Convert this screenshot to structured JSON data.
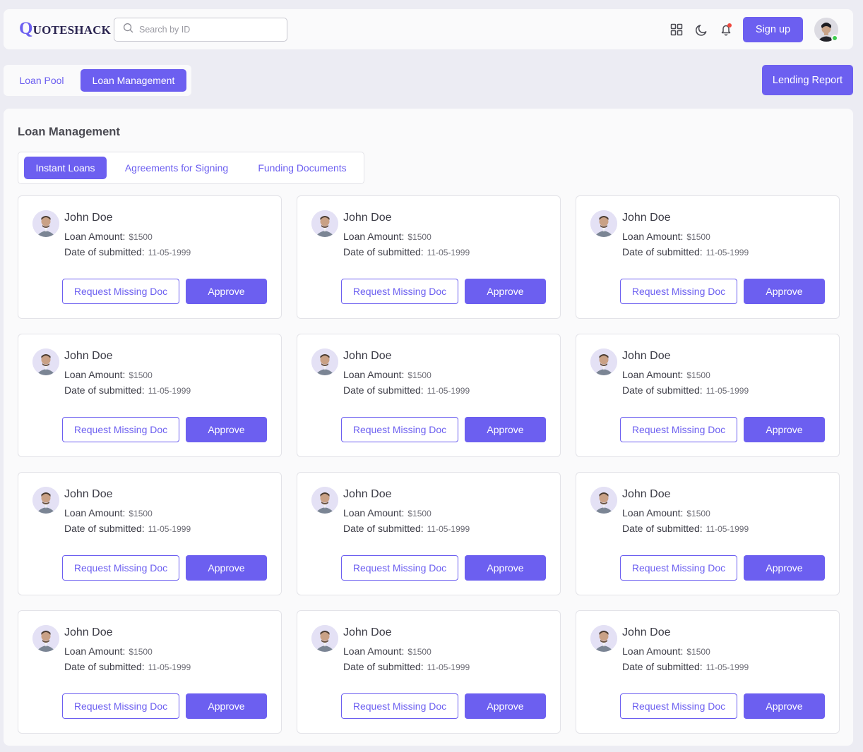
{
  "header": {
    "logo_initial": "Q",
    "logo_rest": "UOTESHACK",
    "search_placeholder": "Search by ID",
    "signup_label": "Sign up",
    "icons": [
      "search-icon",
      "grid-icon",
      "moon-icon",
      "bell-icon"
    ],
    "notification_dot_color": "#f0483e",
    "online_status_color": "#3ecb4f"
  },
  "main_tabs": [
    {
      "label": "Loan Pool",
      "active": false
    },
    {
      "label": "Loan Management",
      "active": true
    }
  ],
  "lending_report_label": "Lending Report",
  "panel": {
    "title": "Loan Management",
    "sub_tabs": [
      {
        "label": "Instant Loans",
        "active": true
      },
      {
        "label": "Agreements for Signing",
        "active": false
      },
      {
        "label": "Funding Documents",
        "active": false
      }
    ]
  },
  "cards": [
    {
      "name": "John Doe",
      "amount_label": "Loan Amount:",
      "amount": "$1500",
      "date_label": "Date of submitted:",
      "date": "11-05-1999",
      "request_label": "Request Missing Doc",
      "approve_label": "Approve"
    },
    {
      "name": "John Doe",
      "amount_label": "Loan Amount:",
      "amount": "$1500",
      "date_label": "Date of submitted:",
      "date": "11-05-1999",
      "request_label": "Request Missing Doc",
      "approve_label": "Approve"
    },
    {
      "name": "John Doe",
      "amount_label": "Loan Amount:",
      "amount": "$1500",
      "date_label": "Date of submitted:",
      "date": "11-05-1999",
      "request_label": "Request Missing Doc",
      "approve_label": "Approve"
    },
    {
      "name": "John Doe",
      "amount_label": "Loan Amount:",
      "amount": "$1500",
      "date_label": "Date of submitted:",
      "date": "11-05-1999",
      "request_label": "Request Missing Doc",
      "approve_label": "Approve"
    },
    {
      "name": "John Doe",
      "amount_label": "Loan Amount:",
      "amount": "$1500",
      "date_label": "Date of submitted:",
      "date": "11-05-1999",
      "request_label": "Request Missing Doc",
      "approve_label": "Approve"
    },
    {
      "name": "John Doe",
      "amount_label": "Loan Amount:",
      "amount": "$1500",
      "date_label": "Date of submitted:",
      "date": "11-05-1999",
      "request_label": "Request Missing Doc",
      "approve_label": "Approve"
    },
    {
      "name": "John Doe",
      "amount_label": "Loan Amount:",
      "amount": "$1500",
      "date_label": "Date of submitted:",
      "date": "11-05-1999",
      "request_label": "Request Missing Doc",
      "approve_label": "Approve"
    },
    {
      "name": "John Doe",
      "amount_label": "Loan Amount:",
      "amount": "$1500",
      "date_label": "Date of submitted:",
      "date": "11-05-1999",
      "request_label": "Request Missing Doc",
      "approve_label": "Approve"
    },
    {
      "name": "John Doe",
      "amount_label": "Loan Amount:",
      "amount": "$1500",
      "date_label": "Date of submitted:",
      "date": "11-05-1999",
      "request_label": "Request Missing Doc",
      "approve_label": "Approve"
    },
    {
      "name": "John Doe",
      "amount_label": "Loan Amount:",
      "amount": "$1500",
      "date_label": "Date of submitted:",
      "date": "11-05-1999",
      "request_label": "Request Missing Doc",
      "approve_label": "Approve"
    },
    {
      "name": "John Doe",
      "amount_label": "Loan Amount:",
      "amount": "$1500",
      "date_label": "Date of submitted:",
      "date": "11-05-1999",
      "request_label": "Request Missing Doc",
      "approve_label": "Approve"
    },
    {
      "name": "John Doe",
      "amount_label": "Loan Amount:",
      "amount": "$1500",
      "date_label": "Date of submitted:",
      "date": "11-05-1999",
      "request_label": "Request Missing Doc",
      "approve_label": "Approve"
    }
  ],
  "colors": {
    "accent": "#6c5ff0",
    "background": "#ececf3",
    "surface": "#fafafb"
  }
}
